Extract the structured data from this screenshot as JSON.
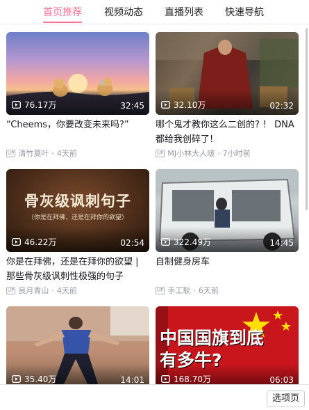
{
  "tabs": [
    {
      "label": "首页推荐",
      "active": true
    },
    {
      "label": "视频动态",
      "active": false
    },
    {
      "label": "直播列表",
      "active": false
    },
    {
      "label": "快速导航",
      "active": false
    }
  ],
  "videos": [
    {
      "title": "“Cheems，你要改变未来吗?”",
      "views": "76.17万",
      "duration": "32:45",
      "author": "清竹莫叶",
      "time": "4天前",
      "thumb_text": ""
    },
    {
      "title": "哪个鬼才教你这么二创的? ！ DNA都给我创碎了!",
      "views": "32.10万",
      "duration": "02:32",
      "author": "MJ小林大人啵",
      "time": "7小时前",
      "thumb_text": ""
    },
    {
      "title": "你是在拜佛，还是在拜你的欲望 | 那些骨灰级讽刺性极强的句子",
      "views": "46.22万",
      "duration": "02:54",
      "author": "良月青山",
      "time": "4天前",
      "thumb_text": "骨灰级讽刺句子",
      "thumb_sub": "（你是在拜佛，还是在拜你的欲望）"
    },
    {
      "title": "自制健身房车",
      "views": "322.49万",
      "duration": "14:45",
      "author": "手工耿",
      "time": "6天前",
      "thumb_text": ""
    },
    {
      "title": "",
      "views": "35.40万",
      "duration": "14:01",
      "author": "",
      "time": "",
      "thumb_text": ""
    },
    {
      "title": "",
      "views": "168.70万",
      "duration": "06:03",
      "author": "",
      "time": "",
      "thumb_text": "中国国旗到底有多牛?"
    }
  ],
  "up_badge": "UP",
  "bottom": {
    "options_label": "选项页"
  },
  "colors": {
    "accent": "#fb7299",
    "text": "#18191c",
    "meta": "#9499a0"
  }
}
